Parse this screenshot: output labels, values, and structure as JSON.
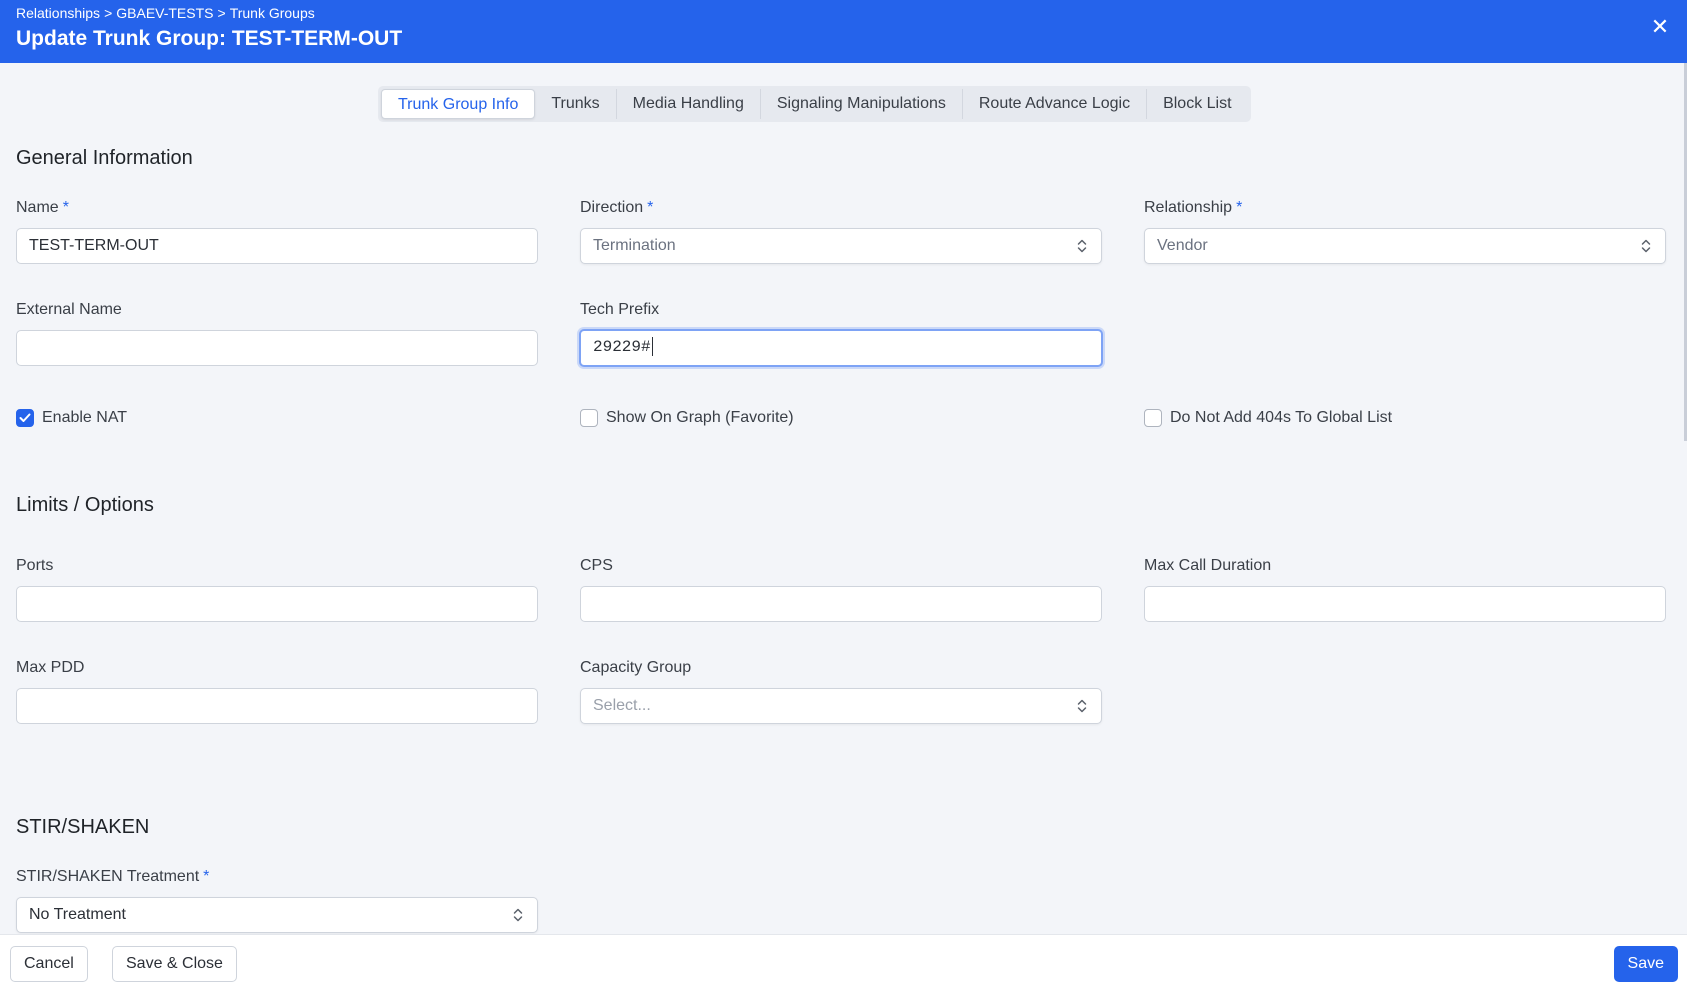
{
  "header": {
    "breadcrumb": [
      "Relationships",
      "GBAEV-TESTS",
      "Trunk Groups"
    ],
    "breadcrumb_sep": ">",
    "title": "Update Trunk Group: TEST-TERM-OUT",
    "close_glyph": "✕"
  },
  "tabs": [
    {
      "label": "Trunk Group Info",
      "active": true
    },
    {
      "label": "Trunks"
    },
    {
      "label": "Media Handling"
    },
    {
      "label": "Signaling Manipulations"
    },
    {
      "label": "Route Advance Logic"
    },
    {
      "label": "Block List"
    }
  ],
  "general": {
    "title": "General Information",
    "name": {
      "label": "Name",
      "required": "*",
      "value": "TEST-TERM-OUT"
    },
    "direction": {
      "label": "Direction",
      "required": "*",
      "value": "Termination"
    },
    "relationship": {
      "label": "Relationship",
      "required": "*",
      "value": "Vendor"
    },
    "external_name": {
      "label": "External Name",
      "value": ""
    },
    "tech_prefix": {
      "label": "Tech Prefix",
      "value": "29229#"
    },
    "enable_nat": {
      "label": "Enable NAT",
      "checked": true
    },
    "show_on_graph": {
      "label": "Show On Graph (Favorite)",
      "checked": false
    },
    "no_404s": {
      "label": "Do Not Add 404s To Global List",
      "checked": false
    }
  },
  "limits": {
    "title": "Limits / Options",
    "ports": {
      "label": "Ports",
      "value": ""
    },
    "cps": {
      "label": "CPS",
      "value": ""
    },
    "max_call_duration": {
      "label": "Max Call Duration",
      "value": ""
    },
    "max_pdd": {
      "label": "Max PDD",
      "value": ""
    },
    "capacity_group": {
      "label": "Capacity Group",
      "placeholder": "Select..."
    }
  },
  "stir": {
    "title": "STIR/SHAKEN",
    "treatment": {
      "label": "STIR/SHAKEN Treatment",
      "required": "*",
      "value": "No Treatment"
    }
  },
  "footer": {
    "cancel": "Cancel",
    "save_close": "Save & Close",
    "save": "Save"
  },
  "colors": {
    "accent": "#2563eb",
    "background": "#f3f5f9"
  }
}
